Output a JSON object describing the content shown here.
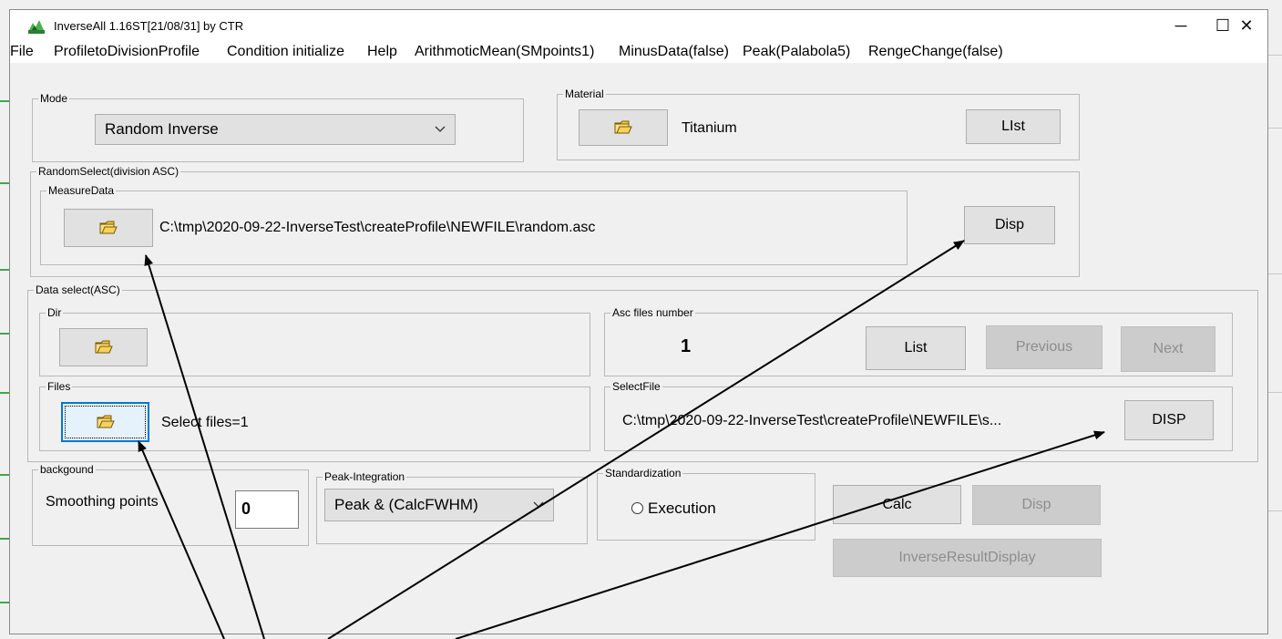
{
  "window": {
    "title": "InverseAll 1.16ST[21/08/31] by CTR",
    "minimize": "─",
    "maximize": "☐",
    "close": "✕"
  },
  "menu": [
    "File",
    "ProfiletoDivisionProfile",
    "Condition initialize",
    "Help",
    "ArithmoticMean(SMpoints1)",
    "MinusData(false)",
    "Peak(Palabola5)",
    "RengeChange(false)"
  ],
  "mode": {
    "legend": "Mode",
    "selected": "Random Inverse"
  },
  "material": {
    "legend": "Material",
    "value": "Titanium",
    "list_button": "LIst"
  },
  "random_select": {
    "legend": "RandomSelect(division ASC)",
    "measure_data_legend": "MeasureData",
    "path": "C:\\tmp\\2020-09-22-InverseTest\\createProfile\\NEWFILE\\random.asc",
    "disp_button": "Disp"
  },
  "data_select": {
    "legend": "Data select(ASC)",
    "dir_legend": "Dir",
    "files_legend": "Files",
    "files_text": "Select files=1",
    "asc_legend": "Asc files number",
    "asc_count": "1",
    "list_button": "List",
    "previous_button": "Previous",
    "next_button": "Next",
    "select_file_legend": "SelectFile",
    "select_file_path": "C:\\tmp\\2020-09-22-InverseTest\\createProfile\\NEWFILE\\s...",
    "disp_button": "DISP"
  },
  "background": {
    "legend": "backgound",
    "label": "Smoothing points",
    "value": "0"
  },
  "peak_integration": {
    "legend": "Peak-Integration",
    "selected": "Peak & (CalcFWHM)"
  },
  "standardization": {
    "legend": "Standardization",
    "radio_label": "Execution"
  },
  "actions": {
    "calc": "Calc",
    "disp": "Disp",
    "inverse_result": "InverseResultDisplay"
  },
  "colors": {
    "focus_blue": "#0078d7",
    "disabled_text": "#8d8d8d",
    "window_bg": "#f0f0f0",
    "icon_green": "#3fa84a",
    "folder_yellow": "#f4c542"
  }
}
